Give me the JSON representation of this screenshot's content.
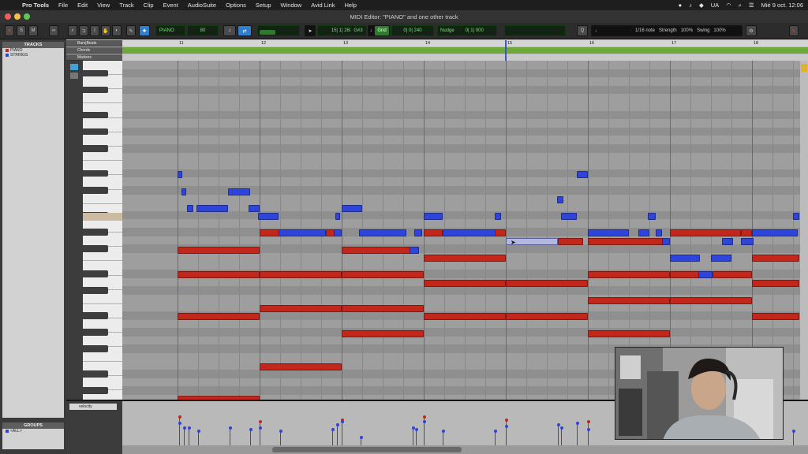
{
  "menubar": {
    "app": "Pro Tools",
    "items": [
      "File",
      "Edit",
      "View",
      "Track",
      "Clip",
      "Event",
      "AudioSuite",
      "Options",
      "Setup",
      "Window",
      "Avid Link",
      "Help"
    ],
    "status": {
      "input": "UA",
      "clock": "Mié 9 oct.  12:06"
    }
  },
  "window": {
    "title": "MIDI Editor: \"PIANO\" and one other track"
  },
  "toolbar": {
    "track_selector": "PIANO",
    "track_number": "80",
    "counter_main": "15| 1| 268",
    "counter_end": "G#3",
    "grid_label": "Grid",
    "grid_value": "0| 0| 240",
    "nudge_label": "Nudge",
    "nudge_value": "0| 1| 000",
    "quantize_value": "1/16 note",
    "strength_label": "Strength",
    "strength_value": "100%",
    "swing_label": "Swing",
    "swing_value": "100%"
  },
  "tracks_panel": {
    "title": "TRACKS",
    "tracks": [
      {
        "name": "PIANO",
        "color": "#c1271b"
      },
      {
        "name": "STRINGS",
        "color": "#2f44d8"
      }
    ]
  },
  "groups_panel": {
    "title": "GROUPS",
    "items": [
      "<ALL>"
    ]
  },
  "rulers": {
    "labels": [
      "Bars|Beats",
      "Chords",
      "Markers"
    ],
    "bars": [
      "11",
      "12",
      "13",
      "14",
      "15",
      "16",
      "17",
      "18"
    ]
  },
  "velocity_lane": {
    "label": "velocity"
  },
  "colors": {
    "piano": "#c1271b",
    "strings": "#2f44d8",
    "selected": "#b3b6de"
  }
}
